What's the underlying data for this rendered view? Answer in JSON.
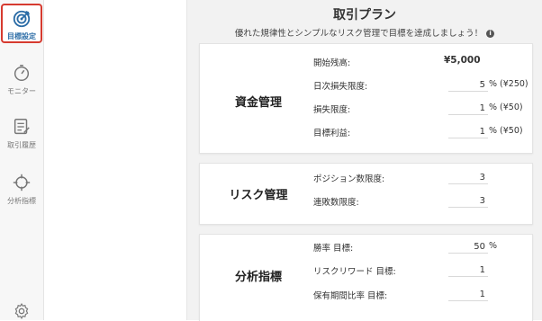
{
  "rail": {
    "items": [
      {
        "label": "目標設定",
        "icon": "target-icon",
        "active": true
      },
      {
        "label": "モニター",
        "icon": "gauge-icon"
      },
      {
        "label": "取引履歴",
        "icon": "history-icon"
      },
      {
        "label": "分析指標",
        "icon": "crosshair-icon"
      },
      {
        "label": "",
        "icon": "gear-icon"
      }
    ]
  },
  "header": {
    "title": "取引プラン",
    "subtitle": "優れた規律性とシンプルなリスク管理で目標を達成しましょう！"
  },
  "cards": {
    "capital": {
      "title": "資金管理",
      "start_balance_label": "開始残高:",
      "start_balance_value": "¥5,000",
      "daily_loss_label": "日次損失限度:",
      "daily_loss_value": "5",
      "daily_loss_suffix": "% (¥250)",
      "loss_label": "損失限度:",
      "loss_value": "1",
      "loss_suffix": "% (¥50)",
      "profit_label": "目標利益:",
      "profit_value": "1",
      "profit_suffix": "% (¥50)"
    },
    "risk": {
      "title": "リスク管理",
      "position_label": "ポジション数限度:",
      "position_value": "3",
      "losing_streak_label": "連敗数限度:",
      "losing_streak_value": "3"
    },
    "analysis": {
      "title": "分析指標",
      "winrate_label": "勝率 目標:",
      "winrate_value": "50",
      "winrate_suffix": "%",
      "rr_label": "リスクリワード 目標:",
      "rr_value": "1",
      "hold_label": "保有期間比率 目標:",
      "hold_value": "1"
    }
  },
  "colors": {
    "accent": "#2b6ca6",
    "highlight_border": "#d63a2f",
    "background": "#f2f2f2"
  }
}
